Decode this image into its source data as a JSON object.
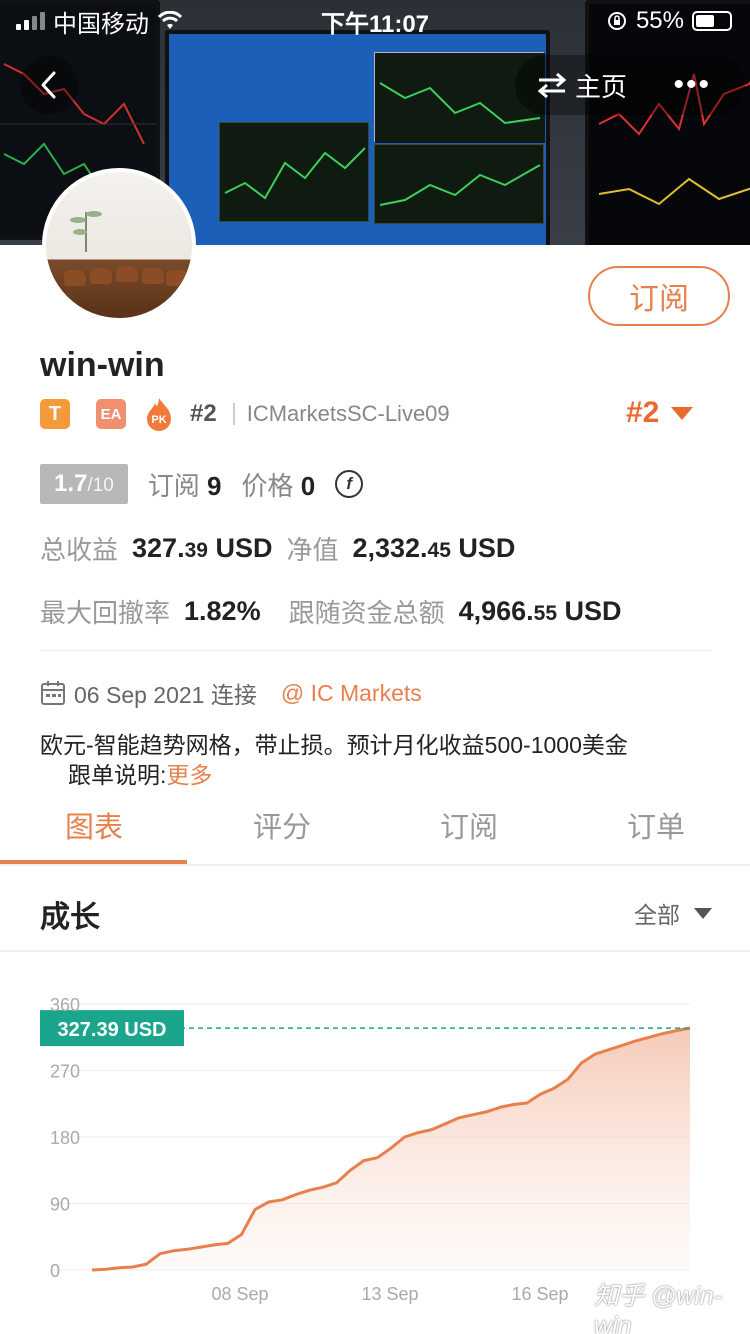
{
  "status_bar": {
    "carrier": "中国移动",
    "time": "下午11:07",
    "battery": "55%"
  },
  "nav": {
    "home_label": "主页",
    "more_glyph": "•••"
  },
  "profile": {
    "subscribe_label": "订阅",
    "name": "win-win",
    "tag_t": "T",
    "tag_ea": "EA",
    "tag_pk": "PK",
    "rank": "#2",
    "account": "ICMarketsSC-Live09",
    "rank_big": "#2"
  },
  "stats": {
    "score": "1.7",
    "score_den": "/10",
    "subscribe_label": "订阅",
    "subscribe_count": "9",
    "price_label": "价格",
    "price_value": "0",
    "coin_glyph": "f",
    "total_profit_label": "总收益",
    "total_profit_int": "327.",
    "total_profit_dec": "39",
    "total_profit_unit": " USD",
    "equity_label": "净值",
    "equity_int": "2,332.",
    "equity_dec": "45",
    "equity_unit": " USD",
    "max_drawdown_label": "最大回撤率",
    "max_drawdown": "1.82%",
    "follow_funds_label": "跟随资金总额",
    "follow_funds_int": "4,966.",
    "follow_funds_dec": "55",
    "follow_funds_unit": " USD"
  },
  "connect": {
    "date_text": "06 Sep 2021 连接",
    "broker": "@ IC Markets"
  },
  "description": {
    "line1": "欧元-智能趋势网格，带止损。预计月化收益500-1000美金",
    "line2_label": "跟单说明:",
    "more": "更多"
  },
  "tabs": [
    {
      "label": "图表",
      "active": true
    },
    {
      "label": "评分",
      "active": false
    },
    {
      "label": "订阅",
      "active": false
    },
    {
      "label": "订单",
      "active": false
    }
  ],
  "growth": {
    "title": "成长",
    "range": "全部"
  },
  "chart_data": {
    "type": "area",
    "y_ticks": [
      "360",
      "270",
      "180",
      "90",
      "0"
    ],
    "x_ticks": [
      "08 Sep",
      "13 Sep",
      "16 Sep"
    ],
    "ylim": [
      0,
      360
    ],
    "current_label": "327.39 USD",
    "current_value": 327.39,
    "line_color": "#e8804d",
    "badge_color": "#1aa58c",
    "grid": true,
    "values": [
      0,
      1,
      3,
      4,
      8,
      22,
      26,
      28,
      31,
      34,
      36,
      48,
      82,
      92,
      95,
      102,
      108,
      112,
      118,
      135,
      148,
      152,
      165,
      180,
      186,
      190,
      198,
      206,
      210,
      214,
      220,
      224,
      226,
      238,
      246,
      258,
      280,
      292,
      298,
      304,
      310,
      315,
      320,
      324,
      327.39
    ]
  },
  "watermark": "知乎 @win-win"
}
